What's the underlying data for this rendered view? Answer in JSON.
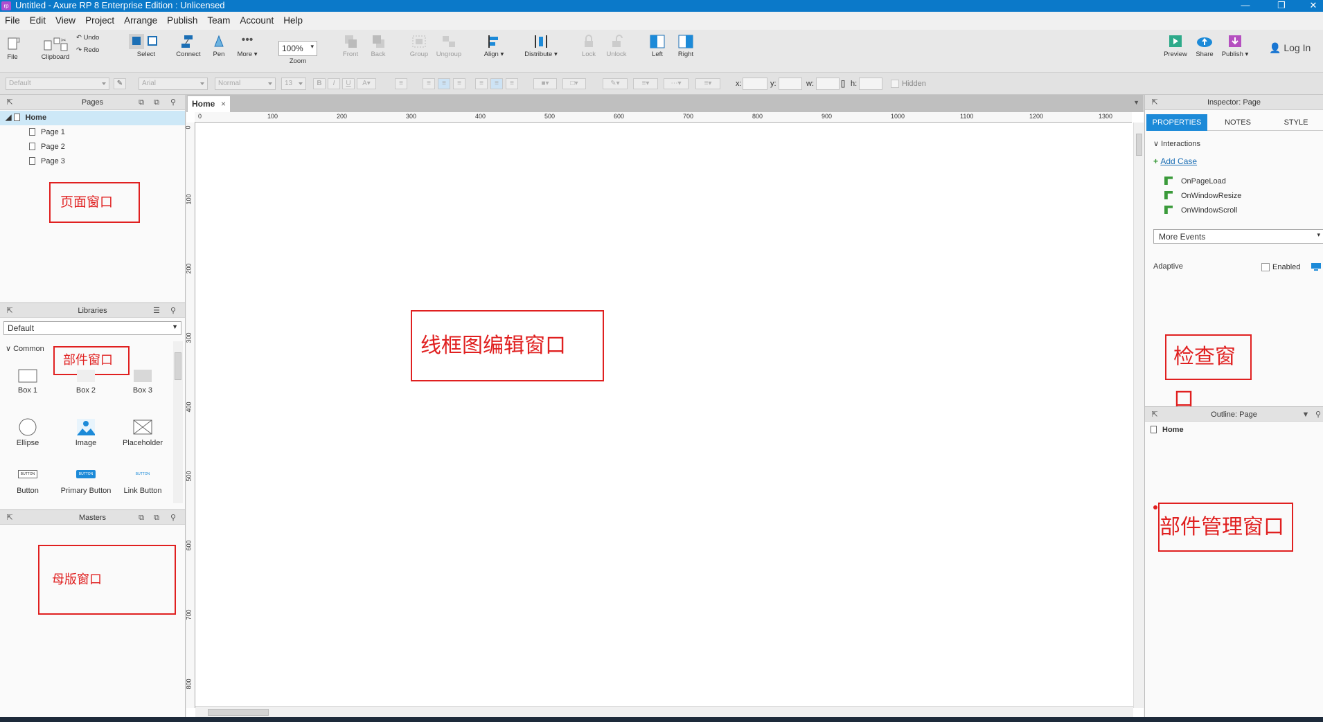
{
  "titlebar": {
    "app_icon": "rp",
    "title": "Untitled - Axure RP 8 Enterprise Edition : Unlicensed"
  },
  "menu": [
    "File",
    "Edit",
    "View",
    "Project",
    "Arrange",
    "Publish",
    "Team",
    "Account",
    "Help"
  ],
  "toolbar": {
    "file": "File",
    "clipboard": "Clipboard",
    "undo": "Undo",
    "redo": "Redo",
    "select": "Select",
    "connect": "Connect",
    "pen": "Pen",
    "more": "More ▾",
    "zoom_value": "100%",
    "zoom": "Zoom",
    "front": "Front",
    "back": "Back",
    "group": "Group",
    "ungroup": "Ungroup",
    "align": "Align ▾",
    "distribute": "Distribute ▾",
    "lock": "Lock",
    "unlock": "Unlock",
    "left": "Left",
    "right": "Right",
    "preview": "Preview",
    "share": "Share",
    "publish": "Publish ▾",
    "login": "Log In"
  },
  "formatbar": {
    "style": "Default",
    "font": "Arial",
    "weight": "Normal",
    "size": "13",
    "x": "x:",
    "y": "y:",
    "w": "w:",
    "h": "h:",
    "hidden": "Hidden"
  },
  "pages": {
    "title": "Pages",
    "root": "Home",
    "items": [
      "Page 1",
      "Page 2",
      "Page 3"
    ],
    "annotation": "页面窗口"
  },
  "libraries": {
    "title": "Libraries",
    "selected": "Default",
    "group": "Common",
    "annotation": "部件窗口",
    "widgets": [
      "Box 1",
      "Box 2",
      "Box 3",
      "Ellipse",
      "Image",
      "Placeholder",
      "Button",
      "Primary Button",
      "Link Button"
    ],
    "button_text": "BUTTON"
  },
  "masters": {
    "title": "Masters",
    "annotation": "母版窗口"
  },
  "canvas": {
    "tab": "Home",
    "annotation": "线框图编辑窗口",
    "hruler": [
      "0",
      "100",
      "200",
      "300",
      "400",
      "500",
      "600",
      "700",
      "800",
      "900",
      "1000",
      "1100",
      "1200",
      "1300"
    ],
    "vruler": [
      "0",
      "100",
      "200",
      "300",
      "400",
      "500",
      "600",
      "700",
      "800"
    ]
  },
  "inspector": {
    "title": "Inspector: Page",
    "tabs": [
      "PROPERTIES",
      "NOTES",
      "STYLE"
    ],
    "interactions": "Interactions",
    "add_case": "Add Case",
    "events": [
      "OnPageLoad",
      "OnWindowResize",
      "OnWindowScroll"
    ],
    "more_events": "More Events",
    "adaptive": "Adaptive",
    "enabled": "Enabled",
    "annotation": "检查窗口"
  },
  "outline": {
    "title": "Outline: Page",
    "root": "Home",
    "annotation": "部件管理窗口"
  },
  "colors": {
    "titlebar": "#0b79c9",
    "accent": "#1c8ad8",
    "annotation": "#e02020",
    "selected_row": "#cde8f7"
  }
}
